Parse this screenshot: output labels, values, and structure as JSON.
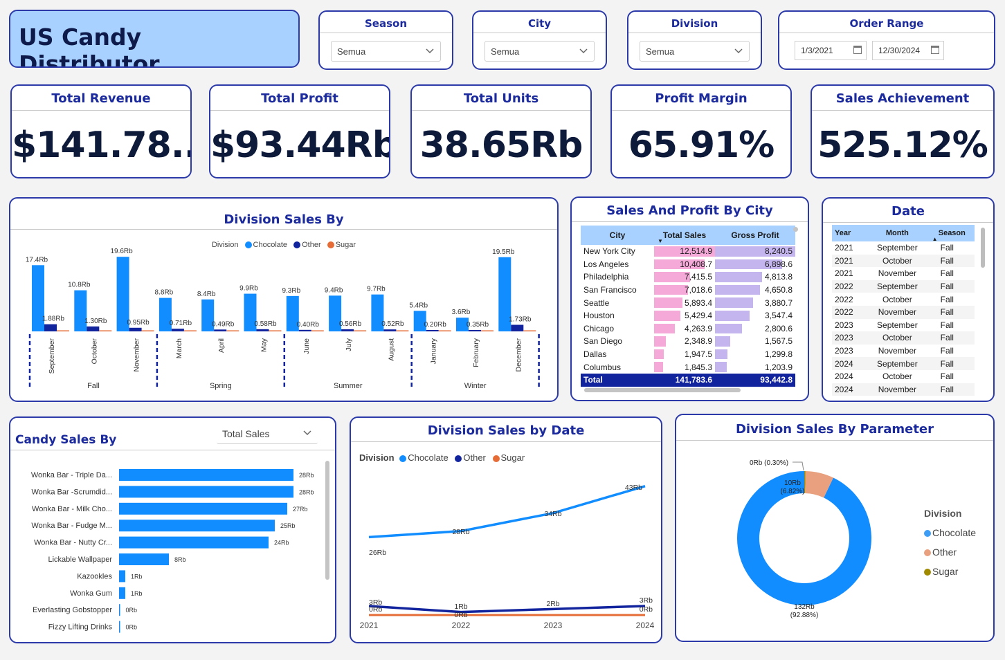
{
  "header": {
    "title": "US Candy Distributor"
  },
  "slicers": {
    "season": {
      "label": "Season",
      "value": "Semua"
    },
    "city": {
      "label": "City",
      "value": "Semua"
    },
    "division": {
      "label": "Division",
      "value": "Semua"
    },
    "order_range": {
      "label": "Order Range",
      "start": "1/3/2021",
      "end": "12/30/2024"
    }
  },
  "kpis": [
    {
      "label": "Total Revenue",
      "value": "$141.78..."
    },
    {
      "label": "Total Profit",
      "value": "$93.44Rb"
    },
    {
      "label": "Total Units",
      "value": "38.65Rb"
    },
    {
      "label": "Profit Margin",
      "value": "65.91%"
    },
    {
      "label": "Sales Achievement",
      "value": "525.12%"
    }
  ],
  "colors": {
    "chocolate": "#118dff",
    "other": "#12239e",
    "sugar": "#e66c37",
    "accent": "#2b3aa8",
    "title_bg": "#a8d1ff"
  },
  "division_sales_by": {
    "title": "Division Sales By",
    "legend_title": "Division",
    "legend": [
      "Chocolate",
      "Other",
      "Sugar"
    ],
    "chart_data": {
      "type": "bar",
      "categories": [
        "September",
        "October",
        "November",
        "March",
        "April",
        "May",
        "June",
        "July",
        "August",
        "January",
        "February",
        "December"
      ],
      "groups": [
        {
          "name": "Fall",
          "categories": [
            "September",
            "October",
            "November"
          ]
        },
        {
          "name": "Spring",
          "categories": [
            "March",
            "April",
            "May"
          ]
        },
        {
          "name": "Summer",
          "categories": [
            "June",
            "July",
            "August"
          ]
        },
        {
          "name": "Winter",
          "categories": [
            "January",
            "February",
            "December"
          ]
        }
      ],
      "series": [
        {
          "name": "Chocolate",
          "values": [
            17.4,
            10.8,
            19.6,
            8.8,
            8.4,
            9.9,
            9.3,
            9.4,
            9.7,
            5.4,
            3.6,
            19.5
          ],
          "labels": [
            "17.4Rb",
            "10.8Rb",
            "19.6Rb",
            "8.8Rb",
            "8.4Rb",
            "9.9Rb",
            "9.3Rb",
            "9.4Rb",
            "9.7Rb",
            "5.4Rb",
            "3.6Rb",
            "19.5Rb"
          ]
        },
        {
          "name": "Other",
          "values": [
            1.88,
            1.3,
            0.95,
            0.71,
            0.49,
            0.58,
            0.4,
            0.56,
            0.52,
            0.2,
            0.35,
            1.73
          ],
          "labels": [
            "1.88Rb",
            "1.30Rb",
            "0.95Rb",
            "0.71Rb",
            "0.49Rb",
            "0.58Rb",
            "0.40Rb",
            "0.56Rb",
            "0.52Rb",
            "0.20Rb",
            "0.35Rb",
            "1.73Rb"
          ]
        },
        {
          "name": "Sugar",
          "values": [
            0.05,
            0.04,
            0.03,
            0.02,
            0.02,
            0.02,
            0.02,
            0.02,
            0.02,
            0.02,
            0.01,
            0.04
          ]
        }
      ],
      "ylim": [
        0,
        20
      ]
    }
  },
  "city_table": {
    "title": "Sales And Profit By City",
    "columns": [
      "City",
      "Total Sales",
      "Gross Profit"
    ],
    "rows": [
      {
        "city": "New York City",
        "sales": "12,514.9",
        "profit": "8,240.5",
        "s": 12514.9,
        "p": 8240.5
      },
      {
        "city": "Los Angeles",
        "sales": "10,408.7",
        "profit": "6,898.6",
        "s": 10408.7,
        "p": 6898.6
      },
      {
        "city": "Philadelphia",
        "sales": "7,415.5",
        "profit": "4,813.8",
        "s": 7415.5,
        "p": 4813.8
      },
      {
        "city": "San Francisco",
        "sales": "7,018.6",
        "profit": "4,650.8",
        "s": 7018.6,
        "p": 4650.8
      },
      {
        "city": "Seattle",
        "sales": "5,893.4",
        "profit": "3,880.7",
        "s": 5893.4,
        "p": 3880.7
      },
      {
        "city": "Houston",
        "sales": "5,429.4",
        "profit": "3,547.4",
        "s": 5429.4,
        "p": 3547.4
      },
      {
        "city": "Chicago",
        "sales": "4,263.9",
        "profit": "2,800.6",
        "s": 4263.9,
        "p": 2800.6
      },
      {
        "city": "San Diego",
        "sales": "2,348.9",
        "profit": "1,567.5",
        "s": 2348.9,
        "p": 1567.5
      },
      {
        "city": "Dallas",
        "sales": "1,947.5",
        "profit": "1,299.8",
        "s": 1947.5,
        "p": 1299.8
      },
      {
        "city": "Columbus",
        "sales": "1,845.3",
        "profit": "1,203.9",
        "s": 1845.3,
        "p": 1203.9
      }
    ],
    "total": {
      "label": "Total",
      "sales": "141,783.6",
      "profit": "93,442.8"
    }
  },
  "date_table": {
    "title": "Date",
    "columns": [
      "Year",
      "Month",
      "Season"
    ],
    "rows": [
      [
        "2021",
        "September",
        "Fall"
      ],
      [
        "2021",
        "October",
        "Fall"
      ],
      [
        "2021",
        "November",
        "Fall"
      ],
      [
        "2022",
        "September",
        "Fall"
      ],
      [
        "2022",
        "October",
        "Fall"
      ],
      [
        "2022",
        "November",
        "Fall"
      ],
      [
        "2023",
        "September",
        "Fall"
      ],
      [
        "2023",
        "October",
        "Fall"
      ],
      [
        "2023",
        "November",
        "Fall"
      ],
      [
        "2024",
        "September",
        "Fall"
      ],
      [
        "2024",
        "October",
        "Fall"
      ],
      [
        "2024",
        "November",
        "Fall"
      ]
    ]
  },
  "candy_sales": {
    "title": "Candy Sales By",
    "dropdown_value": "Total Sales",
    "chart_data": {
      "type": "bar",
      "categories": [
        "Wonka Bar - Triple Da...",
        "Wonka Bar -Scrumdid...",
        "Wonka Bar - Milk Cho...",
        "Wonka Bar - Fudge M...",
        "Wonka Bar - Nutty Cr...",
        "Lickable Wallpaper",
        "Kazookles",
        "Wonka Gum",
        "Everlasting Gobstopper",
        "Fizzy Lifting Drinks"
      ],
      "values": [
        28,
        28,
        27,
        25,
        24,
        8,
        1,
        1,
        0.1,
        0.1
      ],
      "labels": [
        "28Rb",
        "28Rb",
        "27Rb",
        "25Rb",
        "24Rb",
        "8Rb",
        "1Rb",
        "1Rb",
        "0Rb",
        "0Rb"
      ]
    }
  },
  "division_by_date": {
    "title": "Division Sales by Date",
    "legend_title": "Division",
    "legend": [
      "Chocolate",
      "Other",
      "Sugar"
    ],
    "chart_data": {
      "type": "line",
      "x": [
        "2021",
        "2022",
        "2023",
        "2024"
      ],
      "series": [
        {
          "name": "Chocolate",
          "values": [
            26,
            28,
            34,
            43
          ],
          "labels": [
            "26Rb",
            "28Rb",
            "34Rb",
            "43Rb"
          ]
        },
        {
          "name": "Other",
          "values": [
            3,
            1,
            2,
            3
          ],
          "labels": [
            "3Rb",
            "1Rb",
            "2Rb",
            "3Rb"
          ]
        },
        {
          "name": "Sugar",
          "values": [
            0,
            0,
            0,
            0
          ],
          "labels": [
            "0Rb",
            "0Rb",
            "",
            "0Rb"
          ]
        }
      ],
      "ylim": [
        0,
        45
      ]
    }
  },
  "division_param": {
    "title": "Division Sales By Parameter",
    "legend_title": "Division",
    "legend": [
      "Chocolate",
      "Other",
      "Sugar"
    ],
    "chart_data": {
      "type": "pie",
      "labels": [
        "Chocolate",
        "Other",
        "Sugar"
      ],
      "values": [
        92.88,
        6.82,
        0.3
      ],
      "value_labels": [
        "132Rb",
        "10Rb",
        "0Rb"
      ],
      "pct_labels": [
        "(92.88%)",
        "(6.82%)",
        "(0.30%)"
      ],
      "legend_colors": [
        "#118dff",
        "#e8a07e",
        "#a08a00"
      ]
    }
  }
}
